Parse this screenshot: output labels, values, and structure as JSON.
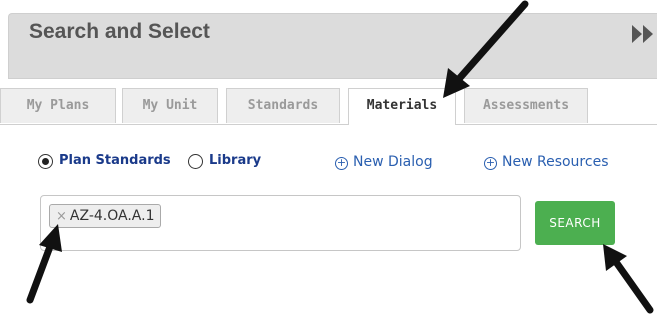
{
  "header": {
    "title": "Search and Select",
    "collapse_icon": "double-chevron-right-icon"
  },
  "tabs": [
    {
      "label": "My Plans",
      "active": false
    },
    {
      "label": "My Unit",
      "active": false
    },
    {
      "label": "Standards",
      "active": false
    },
    {
      "label": "Materials",
      "active": true
    },
    {
      "label": "Assessments",
      "active": false
    }
  ],
  "filters": {
    "plan_standards_label": "Plan Standards",
    "plan_standards_checked": true,
    "library_label": "Library",
    "library_checked": false
  },
  "links": {
    "new_dialog": "New Dialog",
    "new_resources": "New Resources"
  },
  "search": {
    "token_label": "AZ-4.OA.A.1",
    "token_remove": "×",
    "button_label": "SEARCH"
  },
  "colors": {
    "accent_green": "#4caf50",
    "link_blue": "#2a5fb0",
    "header_bg": "#dcdcdc"
  }
}
